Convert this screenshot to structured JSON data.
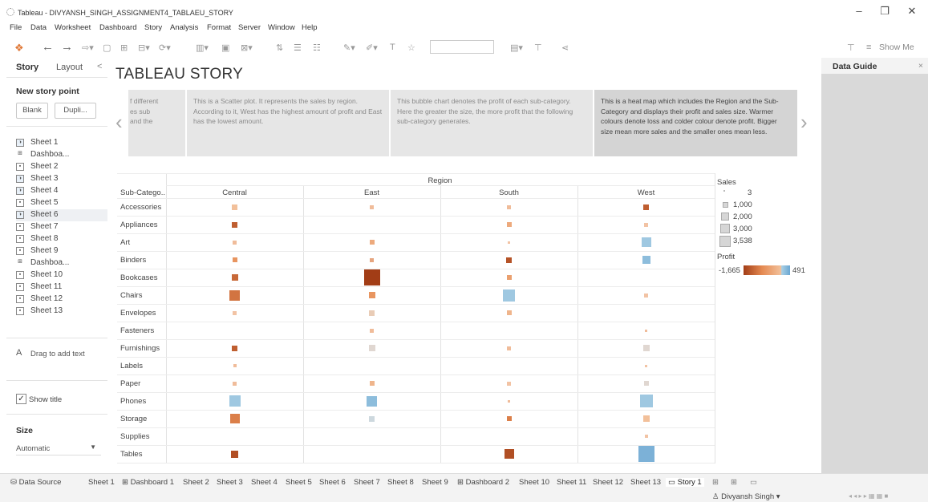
{
  "window": {
    "title": "Tableau - DIVYANSH_SINGH_ASSIGNMENT4_TABLAEU_STORY",
    "min": "–",
    "max": "❐",
    "close": "✕"
  },
  "menu": [
    "File",
    "Data",
    "Worksheet",
    "Dashboard",
    "Story",
    "Analysis",
    "Format",
    "Server",
    "Window",
    "Help"
  ],
  "toolbar": {
    "show_me": "Show Me",
    "back": "←",
    "forward": "→"
  },
  "left": {
    "tab_story": "Story",
    "tab_layout": "Layout",
    "collapse": "<",
    "new_story_point": "New story point",
    "blank": "Blank",
    "duplicate": "Dupli...",
    "sheets": [
      "Sheet 1",
      "Dashboa...",
      "Sheet 2",
      "Sheet 3",
      "Sheet 4",
      "Sheet 5",
      "Sheet 6",
      "Sheet 7",
      "Sheet 8",
      "Sheet 9",
      "Dashboa...",
      "Sheet 10",
      "Sheet 11",
      "Sheet 12",
      "Sheet 13"
    ],
    "drag_text": "Drag to add text",
    "show_title": "Show title",
    "size_label": "Size",
    "size_value": "Automatic"
  },
  "story": {
    "title": "TABLEAU STORY",
    "captions": [
      "f different\nes sub\nand the",
      "This is a Scatter plot. It represents the sales by region. According to it, West has the highest amount of profit and East has the lowest amount.",
      "This bubble chart denotes the profit of each sub-category. Here the greater the size, the more profit that the following sub-category generates.",
      "This is a heat map which includes the Region and the Sub-Category and displays their profit and sales size. Warmer colours denote loss and colder colour denote profit. Bigger size mean more sales and the smaller ones mean less."
    ],
    "prev": "‹",
    "next": "›"
  },
  "chart_data": {
    "type": "heatmap",
    "column_header": "Region",
    "row_header": "Sub-Catego..",
    "columns": [
      "Central",
      "East",
      "South",
      "West"
    ],
    "rows": [
      "Accessories",
      "Appliances",
      "Art",
      "Binders",
      "Bookcases",
      "Chairs",
      "Envelopes",
      "Fasteners",
      "Furnishings",
      "Labels",
      "Paper",
      "Phones",
      "Storage",
      "Supplies",
      "Tables"
    ],
    "size_legend": {
      "title": "Sales",
      "entries": [
        "3",
        "1,000",
        "2,000",
        "3,000",
        "3,538"
      ]
    },
    "color_legend": {
      "title": "Profit",
      "min": "-1,665",
      "max": "491"
    },
    "cells": [
      [
        [
          0.3,
          0.6
        ],
        [
          0.15,
          0.45
        ],
        [
          0.15,
          0.45
        ],
        [
          0.3,
          0.15
        ]
      ],
      [
        [
          0.3,
          0.15
        ],
        [
          null,
          null
        ],
        [
          0.2,
          0.5
        ],
        [
          0.15,
          0.5
        ]
      ],
      [
        [
          0.15,
          0.45
        ],
        [
          0.2,
          0.5
        ],
        [
          0.05,
          0.5
        ],
        [
          0.55,
          0.85
        ]
      ],
      [
        [
          0.2,
          0.4
        ],
        [
          0.15,
          0.3
        ],
        [
          0.25,
          0.1
        ],
        [
          0.45,
          0.9
        ]
      ],
      [
        [
          0.35,
          0.2
        ],
        [
          1.0,
          0.0
        ],
        [
          0.2,
          0.45
        ],
        [
          null,
          null
        ]
      ],
      [
        [
          0.6,
          0.25
        ],
        [
          0.35,
          0.4
        ],
        [
          0.7,
          0.85
        ],
        [
          0.15,
          0.5
        ]
      ],
      [
        [
          0.15,
          0.5
        ],
        [
          0.25,
          0.65
        ],
        [
          0.2,
          0.55
        ],
        [
          null,
          null
        ]
      ],
      [
        [
          null,
          null
        ],
        [
          0.15,
          0.45
        ],
        [
          null,
          null
        ],
        [
          0.05,
          0.45
        ]
      ],
      [
        [
          0.25,
          0.15
        ],
        [
          0.35,
          0.7
        ],
        [
          0.15,
          0.45
        ],
        [
          0.35,
          0.7
        ]
      ],
      [
        [
          0.1,
          0.45
        ],
        [
          null,
          null
        ],
        [
          null,
          null
        ],
        [
          0.05,
          0.5
        ]
      ],
      [
        [
          0.15,
          0.45
        ],
        [
          0.2,
          0.55
        ],
        [
          0.15,
          0.5
        ],
        [
          0.2,
          0.7
        ]
      ],
      [
        [
          0.65,
          0.85
        ],
        [
          0.6,
          0.9
        ],
        [
          0.05,
          0.45
        ],
        [
          0.75,
          0.85
        ]
      ],
      [
        [
          0.55,
          0.3
        ],
        [
          0.3,
          0.75
        ],
        [
          0.2,
          0.3
        ],
        [
          0.35,
          0.6
        ]
      ],
      [
        [
          null,
          null
        ],
        [
          null,
          null
        ],
        [
          null,
          null
        ],
        [
          0.1,
          0.5
        ]
      ],
      [
        [
          0.4,
          0.08
        ],
        [
          null,
          null
        ],
        [
          0.55,
          0.08
        ],
        [
          1.0,
          0.95
        ]
      ]
    ]
  },
  "tabs": [
    "Data Source",
    "Sheet 1",
    "Dashboard 1",
    "Sheet 2",
    "Sheet 3",
    "Sheet 4",
    "Sheet 5",
    "Sheet 6",
    "Sheet 7",
    "Sheet 8",
    "Sheet 9",
    "Dashboard 2",
    "Sheet 10",
    "Sheet 11",
    "Sheet 12",
    "Sheet 13",
    "Story 1"
  ],
  "right": {
    "title": "Data Guide",
    "close": "×"
  },
  "status": {
    "user": "Divyansh Singh"
  }
}
